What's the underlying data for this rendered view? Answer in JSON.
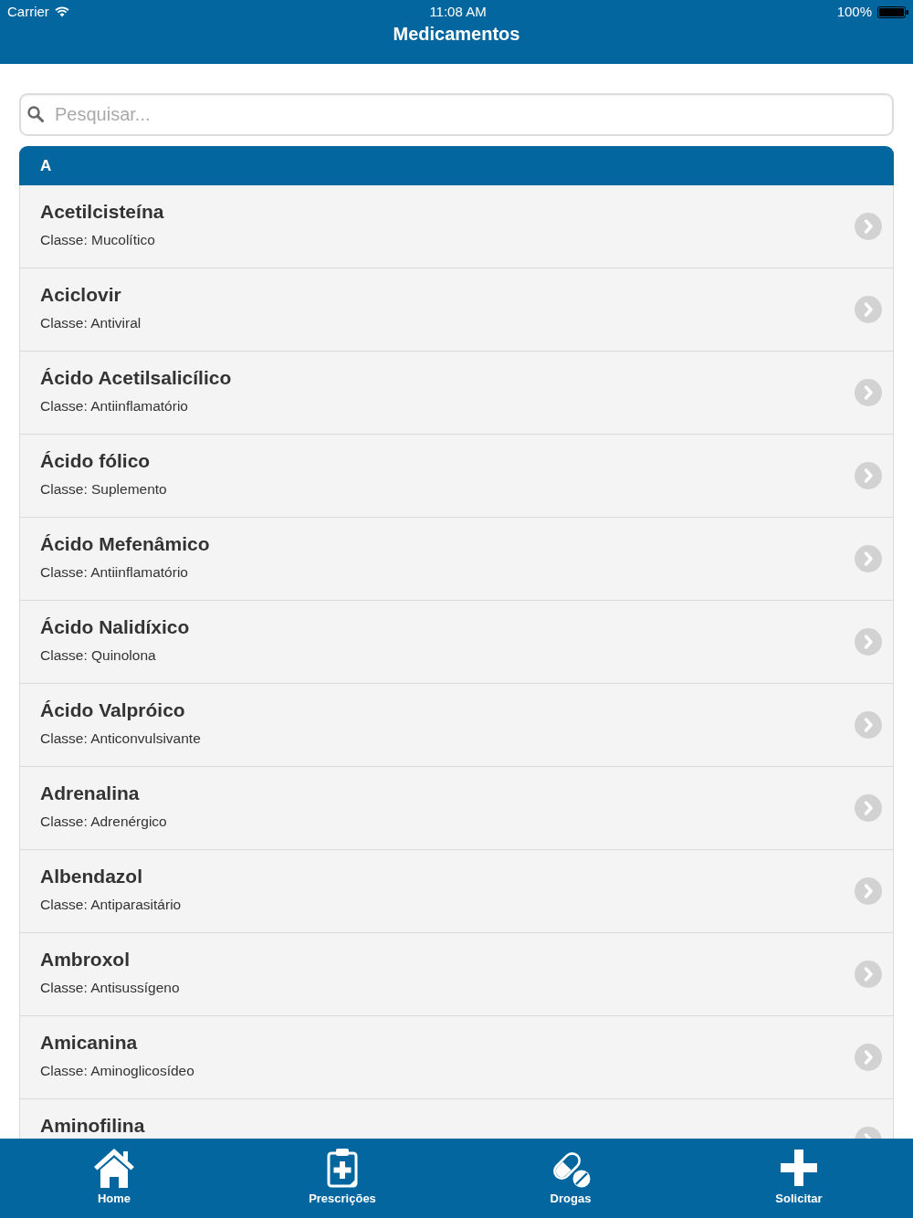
{
  "status_bar": {
    "carrier": "Carrier",
    "time": "11:08 AM",
    "battery": "100%"
  },
  "nav_bar": {
    "title": "Medicamentos"
  },
  "search": {
    "placeholder": "Pesquisar..."
  },
  "sections": [
    {
      "letter": "A",
      "items": [
        {
          "name": "Acetilcisteína",
          "class": "Classe: Mucolítico"
        },
        {
          "name": "Aciclovir",
          "class": "Classe: Antiviral"
        },
        {
          "name": "Ácido Acetilsalicílico",
          "class": "Classe: Antiinflamatório"
        },
        {
          "name": "Ácido fólico",
          "class": "Classe: Suplemento"
        },
        {
          "name": "Ácido Mefenâmico",
          "class": "Classe: Antiinflamatório"
        },
        {
          "name": "Ácido Nalidíxico",
          "class": "Classe: Quinolona"
        },
        {
          "name": "Ácido Valpróico",
          "class": "Classe: Anticonvulsivante"
        },
        {
          "name": "Adrenalina",
          "class": "Classe: Adrenérgico"
        },
        {
          "name": "Albendazol",
          "class": "Classe: Antiparasitário"
        },
        {
          "name": "Ambroxol",
          "class": "Classe: Antisussígeno"
        },
        {
          "name": "Amicanina",
          "class": "Classe: Aminoglicosídeo"
        },
        {
          "name": "Aminofilina"
        }
      ]
    }
  ],
  "tab_bar": [
    {
      "label": "Home",
      "kind": "home"
    },
    {
      "label": "Prescrições",
      "kind": "prescriptions"
    },
    {
      "label": "Drogas",
      "kind": "drugs"
    },
    {
      "label": "Solicitar",
      "kind": "request"
    }
  ]
}
